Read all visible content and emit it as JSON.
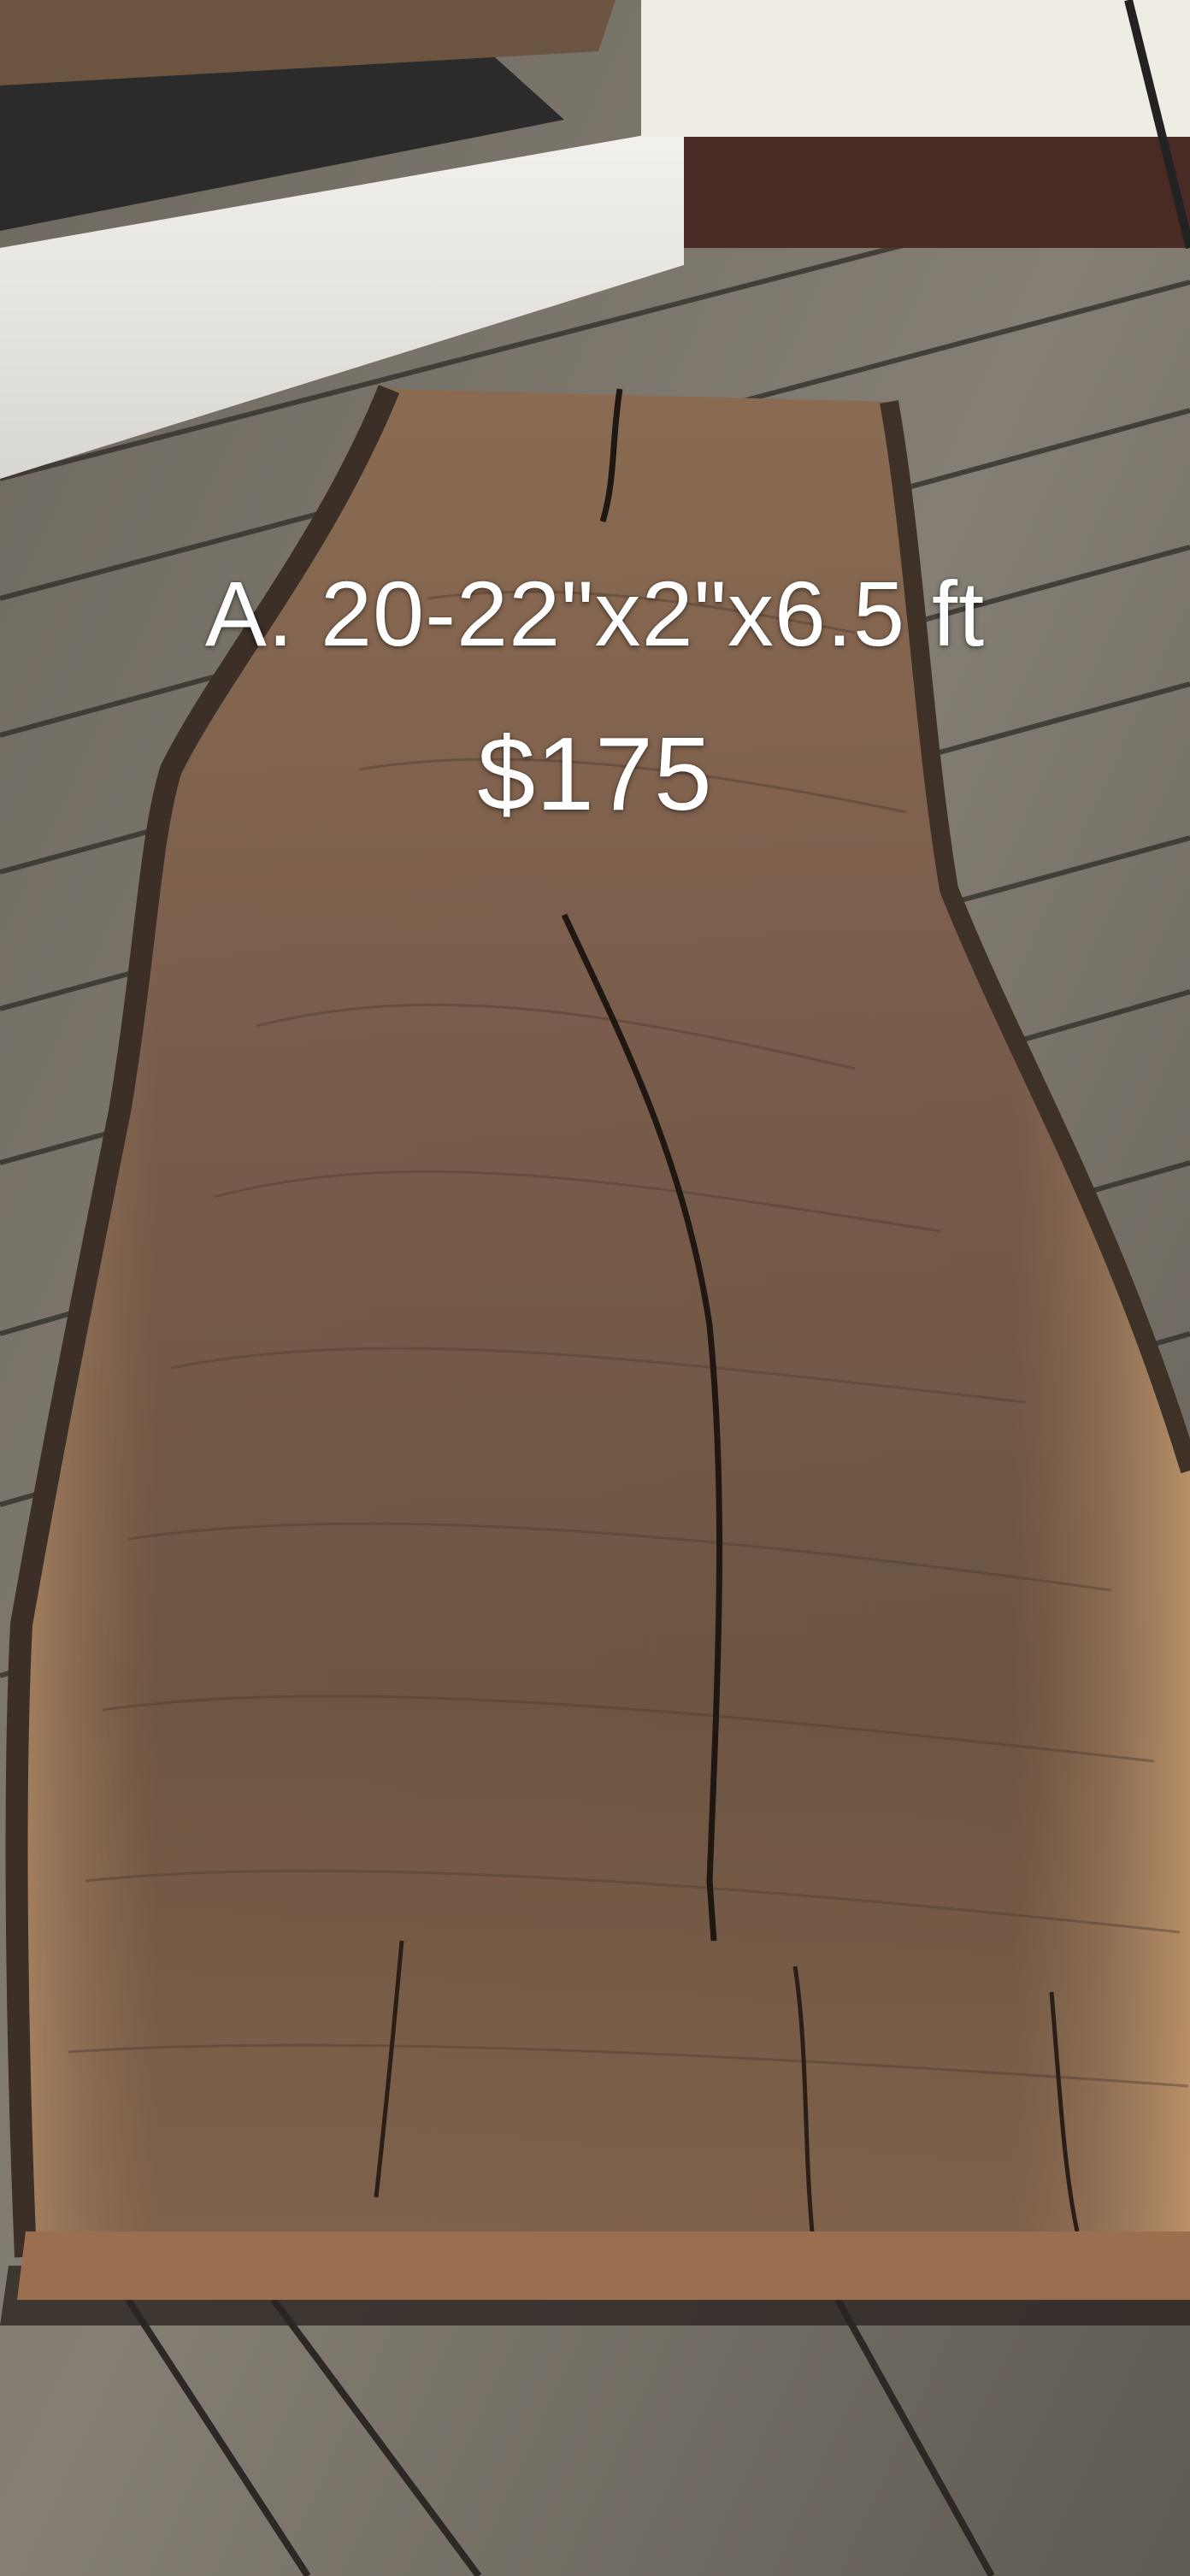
{
  "caption": {
    "line1": "A.  20-22\"x2\"x6.5 ft",
    "line2": "$175"
  },
  "colors": {
    "deck_board": "#7a746c",
    "deck_gap": "#2d2a27",
    "slab_core": "#6e5746",
    "slab_sapwood": "#b88e66",
    "bark_edge": "#3e3128",
    "step_riser": "#e8e6e1",
    "doormat": "#2a2a2a",
    "caption_text": "#ffffff"
  }
}
